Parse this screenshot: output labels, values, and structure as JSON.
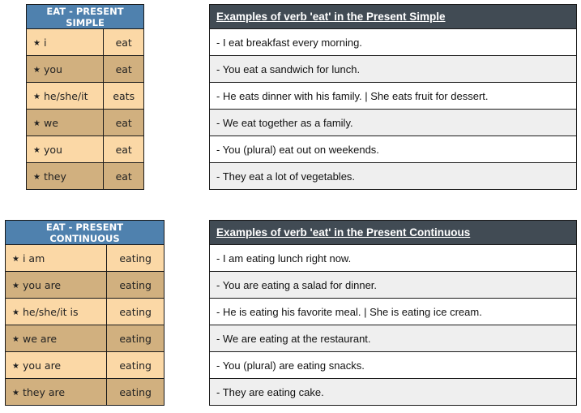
{
  "present_simple": {
    "conjugation": {
      "title": "EAT - PRESENT SIMPLE",
      "rows": [
        {
          "pronoun": "i",
          "verb": "eat"
        },
        {
          "pronoun": "you",
          "verb": "eat"
        },
        {
          "pronoun": "he/she/it",
          "verb": "eats"
        },
        {
          "pronoun": "we",
          "verb": "eat"
        },
        {
          "pronoun": "you",
          "verb": "eat"
        },
        {
          "pronoun": "they",
          "verb": "eat"
        }
      ]
    },
    "examples": {
      "title": "Examples of verb 'eat' in the Present Simple",
      "rows": [
        "- I eat breakfast every morning.",
        "- You eat a sandwich for lunch.",
        "- He eats dinner with his family. | She eats fruit for dessert.",
        "- We eat together as a family.",
        "- You (plural) eat out on weekends.",
        "- They eat a lot of vegetables."
      ]
    }
  },
  "present_continuous": {
    "conjugation": {
      "title": "EAT - PRESENT CONTINUOUS",
      "rows": [
        {
          "pronoun": "i am",
          "verb": "eating"
        },
        {
          "pronoun": "you are",
          "verb": "eating"
        },
        {
          "pronoun": "he/she/it is",
          "verb": "eating"
        },
        {
          "pronoun": "we are",
          "verb": "eating"
        },
        {
          "pronoun": "you are",
          "verb": "eating"
        },
        {
          "pronoun": "they are",
          "verb": "eating"
        }
      ]
    },
    "examples": {
      "title": "Examples of verb 'eat' in the Present Continuous",
      "rows": [
        "- I am eating lunch right now.",
        "- You are eating a salad for dinner.",
        "- He is eating his favorite meal. | She is eating ice cream.",
        "- We are eating at the restaurant.",
        "- You (plural) are eating snacks.",
        "- They are eating cake."
      ]
    }
  },
  "icons": {
    "star": "★"
  },
  "colors": {
    "conj_header": "#4f81ae",
    "conj_row_light": "#fbd8a6",
    "conj_row_dark": "#d1b07f",
    "examples_header": "#414b54",
    "examples_row_alt": "#efefef"
  }
}
